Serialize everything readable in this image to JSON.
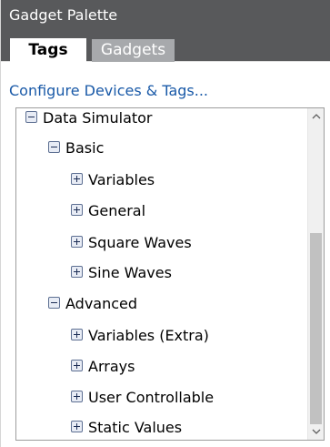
{
  "panel": {
    "title": "Gadget Palette"
  },
  "tabs": [
    {
      "label": "Tags",
      "active": true
    },
    {
      "label": "Gadgets",
      "active": false
    }
  ],
  "configure_link": "Configure Devices & Tags...",
  "tree": {
    "nodes": [
      {
        "label": "Data Simulator",
        "level": 0,
        "state": "expanded"
      },
      {
        "label": "Basic",
        "level": 1,
        "state": "expanded"
      },
      {
        "label": "Variables",
        "level": 2,
        "state": "collapsed"
      },
      {
        "label": "General",
        "level": 2,
        "state": "collapsed"
      },
      {
        "label": "Square Waves",
        "level": 2,
        "state": "collapsed"
      },
      {
        "label": "Sine Waves",
        "level": 2,
        "state": "collapsed"
      },
      {
        "label": "Advanced",
        "level": 1,
        "state": "expanded"
      },
      {
        "label": "Variables (Extra)",
        "level": 2,
        "state": "collapsed"
      },
      {
        "label": "Arrays",
        "level": 2,
        "state": "collapsed"
      },
      {
        "label": "User Controllable",
        "level": 2,
        "state": "collapsed"
      },
      {
        "label": "Static Values",
        "level": 2,
        "state": "collapsed"
      }
    ]
  },
  "icons": {
    "expanded": "minus-box-icon",
    "collapsed": "plus-box-icon",
    "scroll_up": "chevron-up-icon",
    "scroll_down": "chevron-down-icon"
  },
  "colors": {
    "header_bg": "#58595b",
    "inactive_tab_bg": "#a7a9ac",
    "link": "#1a5aa8",
    "scroll_thumb": "#c1c1c1"
  }
}
